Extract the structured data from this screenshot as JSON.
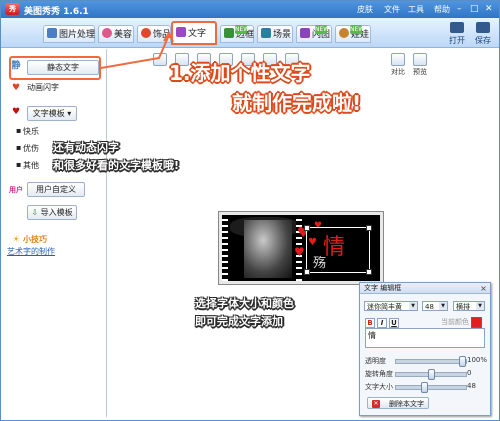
{
  "app": {
    "title": "美图秀秀 1.6.1",
    "logo_text": "秀"
  },
  "menu": {
    "items": [
      "皮肤",
      "文件",
      "工具",
      "帮助"
    ]
  },
  "window_controls": {
    "minimize": "–",
    "maximize": "□",
    "close": "✕"
  },
  "tabs": [
    {
      "label": "图片处理",
      "icon": "image-icon",
      "color": "#4a7fc1"
    },
    {
      "label": "美容",
      "icon": "face-icon",
      "color": "#e0578a"
    },
    {
      "label": "饰品",
      "icon": "heart-icon",
      "color": "#e0462a"
    },
    {
      "label": "文字",
      "icon": "text-icon",
      "color": "#9b48c2"
    },
    {
      "label": "边框",
      "icon": "frame-icon",
      "color": "#3a8f3a"
    },
    {
      "label": "场景",
      "icon": "scene-icon",
      "color": "#2a7fa0"
    },
    {
      "label": "闪图",
      "icon": "flash-icon",
      "color": "#8a44b8"
    },
    {
      "label": "娃娃",
      "icon": "doll-icon",
      "color": "#c6832b"
    }
  ],
  "new_badge": "NEW",
  "top_buttons": {
    "open": "打开",
    "save": "保存"
  },
  "sidebar": {
    "static_text": "静态文字",
    "static_icon_label": "静",
    "animated_text": "动画闪字",
    "template_btn": "文字模板",
    "template_items": [
      "快乐",
      "优伤",
      "其他"
    ],
    "user_custom": "用户自定义",
    "import_template": "导入模板",
    "tip_title": "小技巧",
    "tip_link": "艺术字的制作"
  },
  "canvas_tools": [
    "",
    "",
    "",
    "",
    "",
    "",
    "",
    "对比",
    "预览"
  ],
  "annotations": {
    "note1_line1": "1.添加个性文字",
    "note1_line2": "就制作完成啦!",
    "note2_line1": "还有动态闪字",
    "note2_line2": "和很多好看的文字模板哦!",
    "note3_line1": "选择字体大小和颜色",
    "note3_line2": "即可完成文字添加"
  },
  "photo_text": {
    "big_char": "情",
    "small_char": "殇"
  },
  "editor": {
    "title": "文字 编辑框",
    "font": "迷你简丰黄",
    "size": "48",
    "style": "横排",
    "current_color_label": "当前颜色",
    "current_color": "#e02020",
    "text_value": "情",
    "transparency_label": "透明度",
    "transparency_value": "100%",
    "transparency": 1.0,
    "rotation_label": "旋转角度",
    "rotation_value": "0",
    "rotation": 0.5,
    "font_size_label": "文字大小",
    "font_size_value": "48",
    "font_size": 0.4,
    "delete_label": "删除本文字",
    "format_buttons": [
      "B",
      "I",
      "U"
    ]
  }
}
